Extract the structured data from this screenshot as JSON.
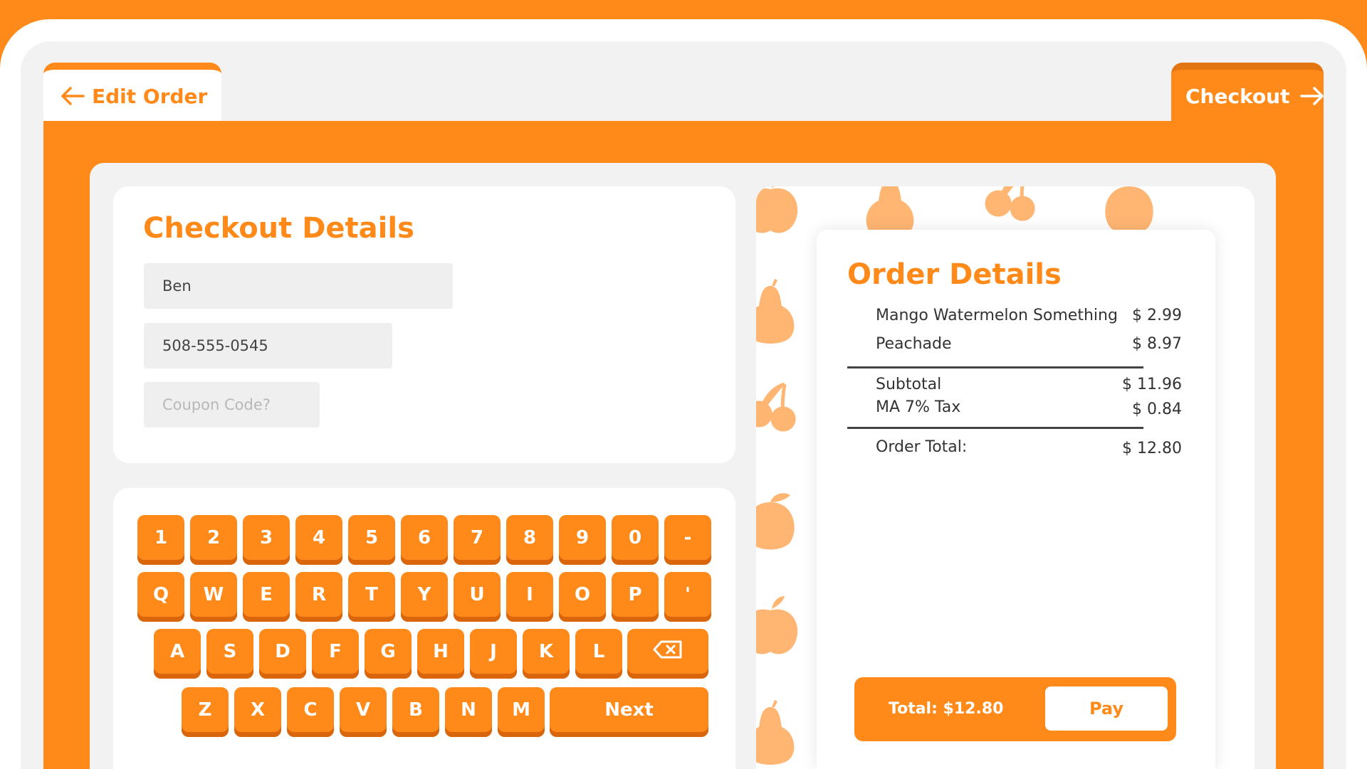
{
  "nav": {
    "back_label": "Edit Order",
    "next_label": "Checkout"
  },
  "checkout": {
    "title": "Checkout Details",
    "name_value": "Ben",
    "phone_value": "508-555-0545",
    "coupon_placeholder": "Coupon Code?"
  },
  "keyboard": {
    "row1": [
      "1",
      "2",
      "3",
      "4",
      "5",
      "6",
      "7",
      "8",
      "9",
      "0",
      "-"
    ],
    "row2": [
      "Q",
      "W",
      "E",
      "R",
      "T",
      "Y",
      "U",
      "I",
      "O",
      "P",
      "'"
    ],
    "row3": [
      "A",
      "S",
      "D",
      "F",
      "G",
      "H",
      "J",
      "K",
      "L"
    ],
    "row4": [
      "Z",
      "X",
      "C",
      "V",
      "B",
      "N",
      "M"
    ],
    "next_label": "Next",
    "backspace_icon": "backspace-icon"
  },
  "order": {
    "title": "Order Details",
    "items": [
      {
        "name": "Mango Watermelon Something",
        "price": "$ 2.99"
      },
      {
        "name": "Peachade",
        "price": "$ 8.97"
      }
    ],
    "subtotal_label": "Subtotal",
    "subtotal_value": "$ 11.96",
    "tax_label": "MA 7% Tax",
    "tax_value": "$ 0.84",
    "total_label": "Order Total:",
    "total_value": "$ 12.80",
    "paybar_total": "Total: $12.80",
    "pay_label": "Pay"
  },
  "colors": {
    "accent": "#FF8A1A",
    "key_shadow": "#D9660D",
    "panel": "#F2F2F2",
    "fruit": "#FFB673"
  }
}
